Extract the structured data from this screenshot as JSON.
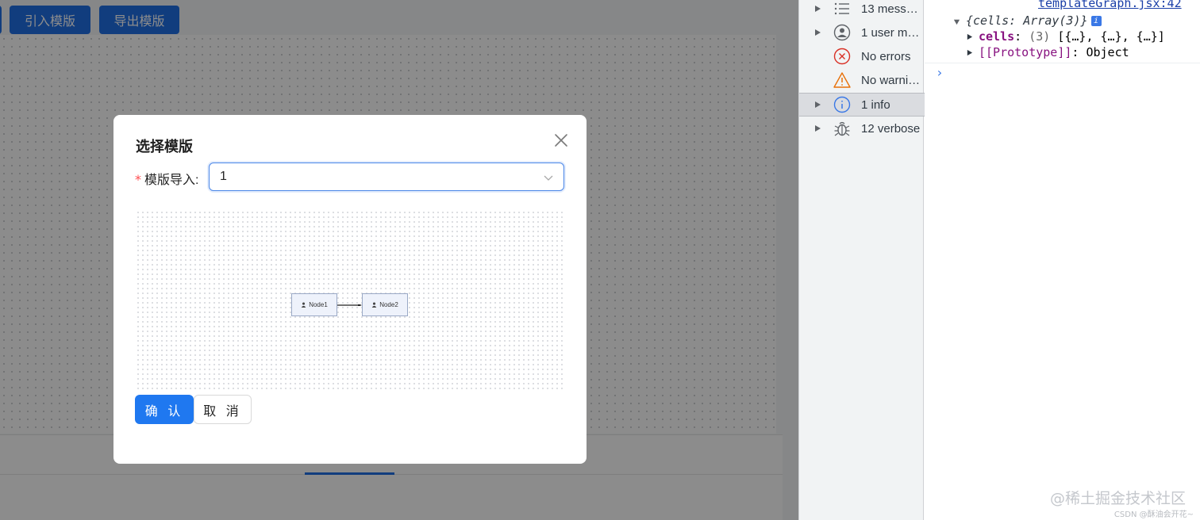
{
  "toolbar": {
    "import_label": "引入模版",
    "export_label": "导出模版"
  },
  "modal": {
    "title": "选择模版",
    "form_required_mark": "*",
    "form_label": "模版导入:",
    "select_value": "1",
    "preview": {
      "nodes": [
        {
          "label": "Node1"
        },
        {
          "label": "Node2"
        }
      ]
    },
    "confirm_label": "确 认",
    "cancel_label": "取 消"
  },
  "devtools": {
    "filters": [
      {
        "label": "13 mess…",
        "icon": "list-icon"
      },
      {
        "label": "1 user m…",
        "icon": "user-icon"
      },
      {
        "label": "No errors",
        "icon": "error-icon"
      },
      {
        "label": "No warni…",
        "icon": "warning-icon"
      },
      {
        "label": "1 info",
        "icon": "info-icon"
      },
      {
        "label": "12 verbose",
        "icon": "bug-icon"
      }
    ],
    "console": {
      "source_link": "templateGraph.jsx:42",
      "object_preview": "{cells: Array(3)}",
      "info_badge": "i",
      "cells_key": "cells",
      "cells_count": "(3)",
      "cells_value": "[{…}, {…}, {…}]",
      "proto_key": "[[Prototype]]",
      "proto_value": "Object",
      "prompt": "›"
    }
  },
  "watermark": {
    "main": "@稀土掘金技术社区",
    "sub": "CSDN @酥油会开花~"
  },
  "colors": {
    "primary": "#1f6fe6",
    "error": "#d93025",
    "warning": "#e8710a",
    "info": "#3a78e6"
  }
}
